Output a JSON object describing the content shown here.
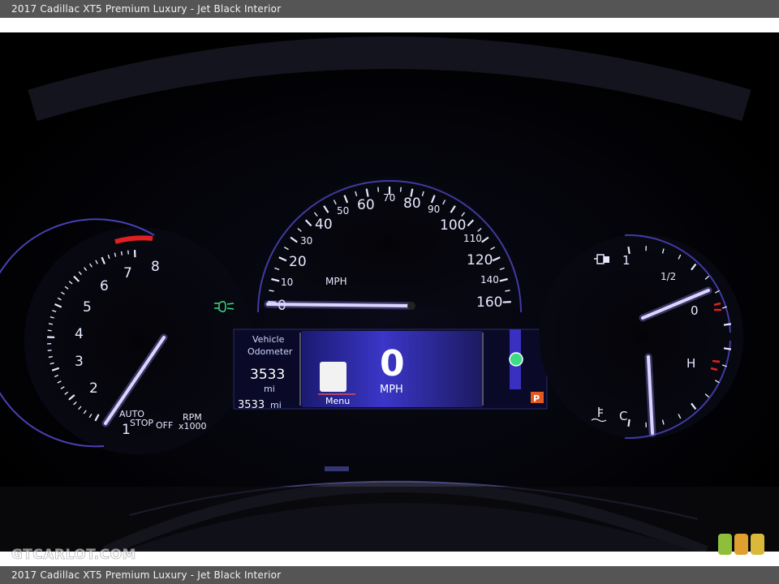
{
  "caption": "2017 Cadillac XT5 Premium Luxury - Jet Black Interior",
  "watermark": "GTCARLOT.COM",
  "logo_colors": [
    "#8fbf3a",
    "#e0a030",
    "#d9b83a"
  ],
  "colors": {
    "accent": "#6a5cff",
    "needle": "#ffffff",
    "redline": "#e02020",
    "lcd": "#2a2aa8",
    "indicator_green": "#3ddc84",
    "park_orange": "#e05a20"
  },
  "tach": {
    "labels": [
      "1",
      "2",
      "3",
      "4",
      "5",
      "6",
      "7",
      "8"
    ],
    "auto_stop": "AUTO\nSTOP",
    "auto_stop_line1": "AUTO",
    "auto_stop_line2": "STOP",
    "off": "OFF",
    "unit1": "RPM",
    "unit2": "x1000",
    "value": 0.8
  },
  "speedo": {
    "labels": [
      "0",
      "10",
      "20",
      "30",
      "40",
      "50",
      "60",
      "70",
      "80",
      "90",
      "100",
      "110",
      "120",
      "140",
      "160"
    ],
    "unit": "MPH",
    "value": 0
  },
  "dic": {
    "title1": "Vehicle",
    "title2": "Odometer",
    "odometer": "3533",
    "odometer_unit": "mi",
    "trip": "3533",
    "trip_unit": "mi",
    "menu": "Menu",
    "speed": "0",
    "speed_unit": "MPH",
    "gear": "P"
  },
  "fuel": {
    "full": "1",
    "half": "1/2",
    "empty": "0",
    "level": 0.1
  },
  "temp": {
    "hot": "H",
    "cold": "C"
  }
}
